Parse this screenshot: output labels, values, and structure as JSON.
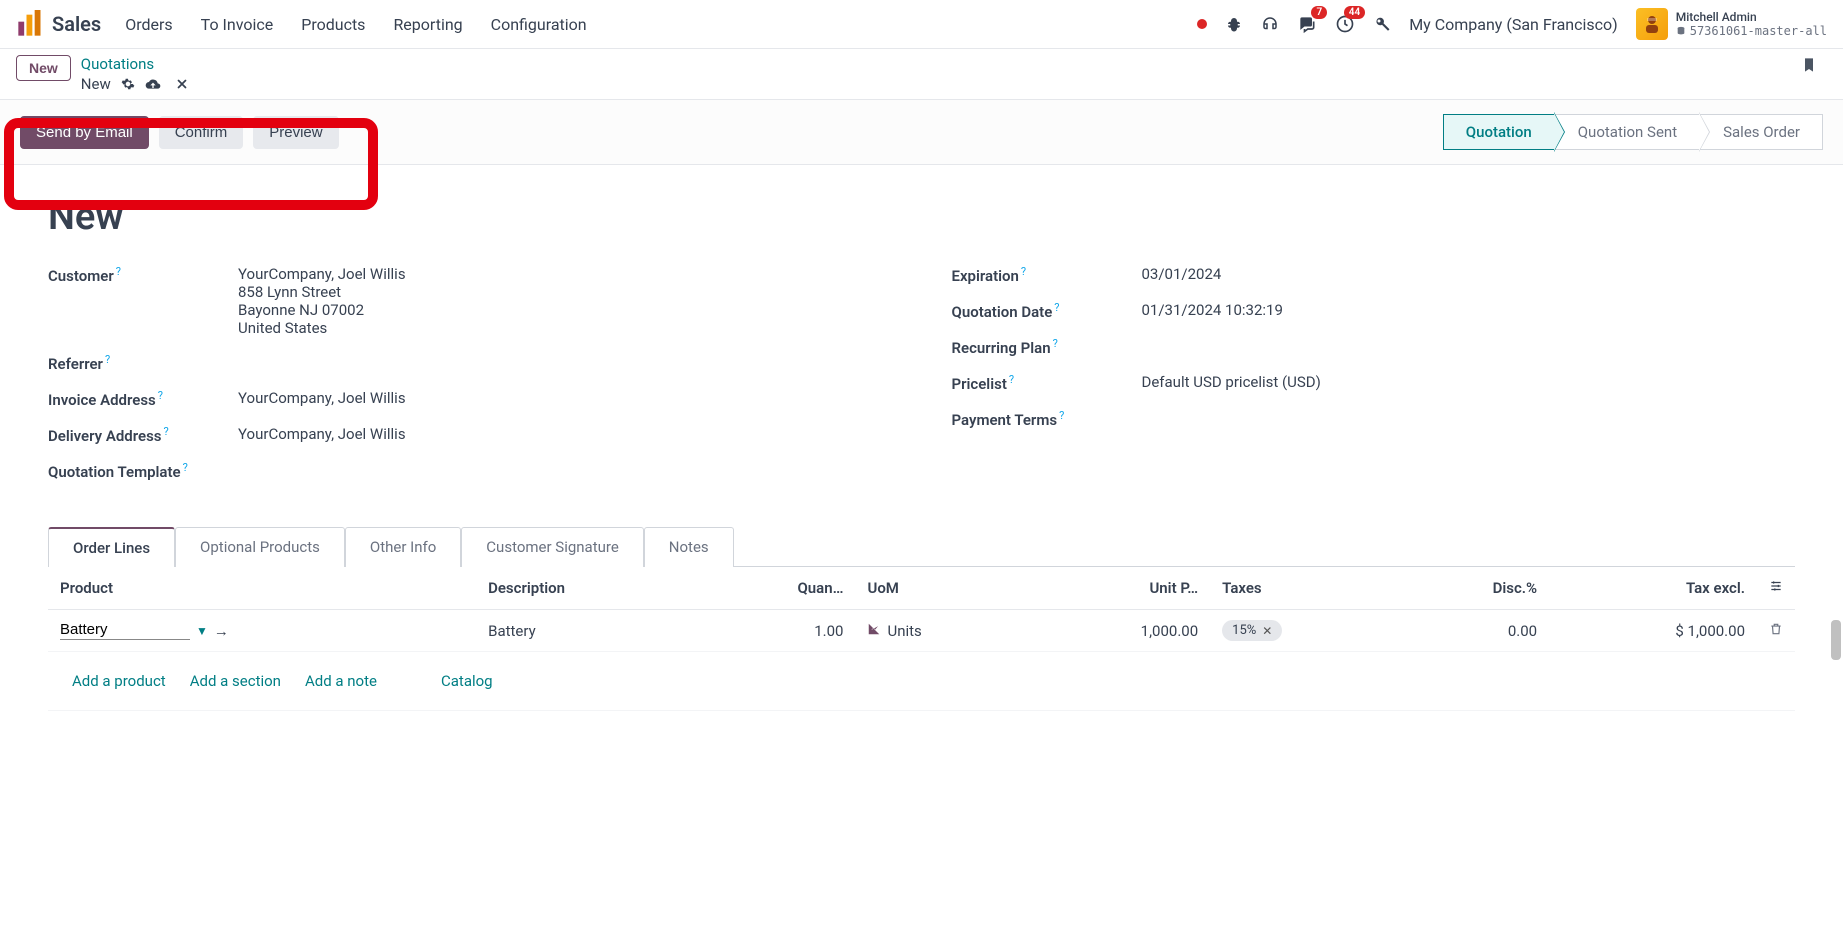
{
  "app": {
    "title": "Sales"
  },
  "nav": {
    "orders": "Orders",
    "to_invoice": "To Invoice",
    "products": "Products",
    "reporting": "Reporting",
    "configuration": "Configuration"
  },
  "topbar": {
    "company": "My Company (San Francisco)",
    "chat_badge": "7",
    "activity_badge": "44"
  },
  "user": {
    "name": "Mitchell Admin",
    "db": "57361061-master-all"
  },
  "breadcrumb": {
    "new_btn": "New",
    "quotations": "Quotations",
    "current": "New"
  },
  "actions": {
    "send_email": "Send by Email",
    "confirm": "Confirm",
    "preview": "Preview"
  },
  "status": {
    "quotation": "Quotation",
    "sent": "Quotation Sent",
    "order": "Sales Order"
  },
  "form": {
    "title": "New",
    "labels": {
      "customer": "Customer",
      "referrer": "Referrer",
      "invoice_addr": "Invoice Address",
      "delivery_addr": "Delivery Address",
      "quote_tmpl": "Quotation Template",
      "expiration": "Expiration",
      "quote_date": "Quotation Date",
      "recurring": "Recurring Plan",
      "pricelist": "Pricelist",
      "payment_terms": "Payment Terms"
    },
    "values": {
      "customer_name": "YourCompany, Joel Willis",
      "customer_addr1": "858 Lynn Street",
      "customer_addr2": "Bayonne NJ 07002",
      "customer_addr3": "United States",
      "invoice_addr": "YourCompany, Joel Willis",
      "delivery_addr": "YourCompany, Joel Willis",
      "expiration": "03/01/2024",
      "quote_date": "01/31/2024 10:32:19",
      "pricelist": "Default USD pricelist (USD)"
    }
  },
  "tabs": {
    "order_lines": "Order Lines",
    "optional": "Optional Products",
    "other": "Other Info",
    "signature": "Customer Signature",
    "notes": "Notes"
  },
  "table": {
    "headers": {
      "product": "Product",
      "description": "Description",
      "quantity": "Quan…",
      "uom": "UoM",
      "unit_price": "Unit P…",
      "taxes": "Taxes",
      "disc": "Disc.%",
      "tax_excl": "Tax excl."
    },
    "rows": [
      {
        "product": "Battery",
        "description": "Battery",
        "qty": "1.00",
        "uom": "Units",
        "unit_price": "1,000.00",
        "tax": "15%",
        "disc": "0.00",
        "tax_excl": "$ 1,000.00"
      }
    ],
    "footer_links": {
      "add_product": "Add a product",
      "add_section": "Add a section",
      "add_note": "Add a note",
      "catalog": "Catalog"
    }
  }
}
